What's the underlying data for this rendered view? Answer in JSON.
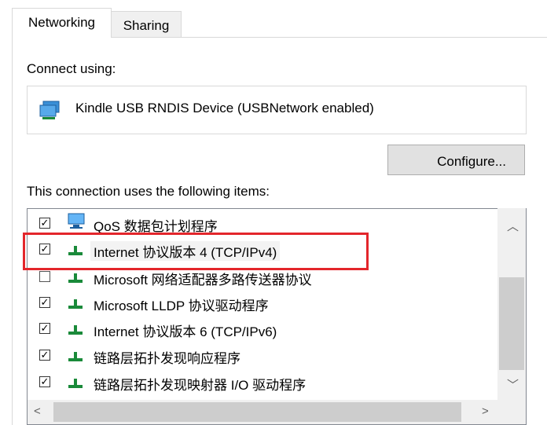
{
  "tabs": [
    {
      "label": "Networking",
      "active": true
    },
    {
      "label": "Sharing",
      "active": false
    }
  ],
  "connect_using": {
    "label": "Connect using:",
    "device": "Kindle USB RNDIS Device (USBNetwork enabled)",
    "device_icon": "network-adapter-icon"
  },
  "configure_button": "Configure...",
  "items_label": "This connection uses the following items:",
  "items": [
    {
      "label": "QoS 数据包计划程序",
      "checked": true,
      "icon": "qos-icon"
    },
    {
      "label": "Internet 协议版本 4 (TCP/IPv4)",
      "checked": true,
      "icon": "protocol-icon",
      "selected": true
    },
    {
      "label": "Microsoft 网络适配器多路传送器协议",
      "checked": false,
      "icon": "protocol-icon"
    },
    {
      "label": "Microsoft LLDP 协议驱动程序",
      "checked": true,
      "icon": "protocol-icon"
    },
    {
      "label": "Internet 协议版本 6 (TCP/IPv6)",
      "checked": true,
      "icon": "protocol-icon"
    },
    {
      "label": "链路层拓扑发现响应程序",
      "checked": true,
      "icon": "protocol-icon"
    },
    {
      "label": "链路层拓扑发现映射器 I/O 驱动程序",
      "checked": true,
      "icon": "protocol-icon"
    }
  ],
  "colors": {
    "highlight_box": "#e3262b",
    "protocol_icon": "#1a8a3a"
  }
}
